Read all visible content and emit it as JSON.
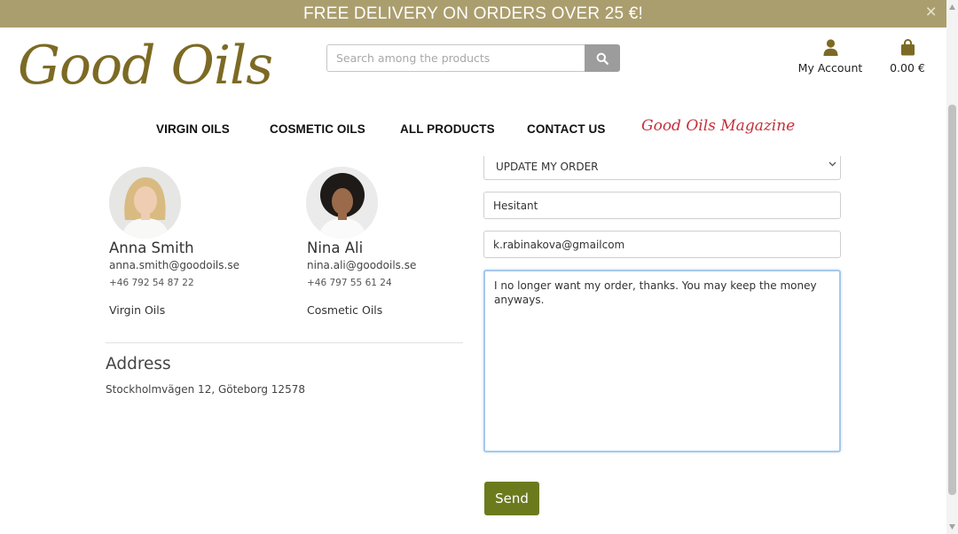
{
  "banner": {
    "text": "FREE DELIVERY ON ORDERS OVER 25 €!",
    "close": "×"
  },
  "logo": {
    "text": "Good Oils"
  },
  "search": {
    "placeholder": "Search among the products",
    "icon": "search-icon"
  },
  "header": {
    "account_label": "My Account",
    "account_icon": "user-icon",
    "cart_total": "0.00 €",
    "cart_icon": "shopping-bag-icon"
  },
  "nav": {
    "items": [
      "VIRGIN OILS",
      "COSMETIC OILS",
      "ALL PRODUCTS",
      "CONTACT US"
    ],
    "magazine": "Good Oils Magazine"
  },
  "contacts": [
    {
      "name": "Anna Smith",
      "email": "anna.smith@goodoils.se",
      "phone": "+46 792 54 87 22",
      "department": "Virgin Oils"
    },
    {
      "name": "Nina Ali",
      "email": "nina.ali@goodoils.se",
      "phone": "+46 797 55 61 24",
      "department": "Cosmetic Oils"
    }
  ],
  "address": {
    "title": "Address",
    "line": "Stockholmvägen 12, Göteborg 12578"
  },
  "form": {
    "subject": "UPDATE MY ORDER",
    "name": "Hesitant",
    "email": "k.rabinakova@gmailcom",
    "message": "I no longer want my order, thanks. You may keep the money anyways.",
    "send_label": "Send"
  },
  "colors": {
    "banner": "#ab9e6e",
    "logo": "#7c6a24",
    "magazine": "#c3303b",
    "send_button": "#6c7a1e"
  }
}
